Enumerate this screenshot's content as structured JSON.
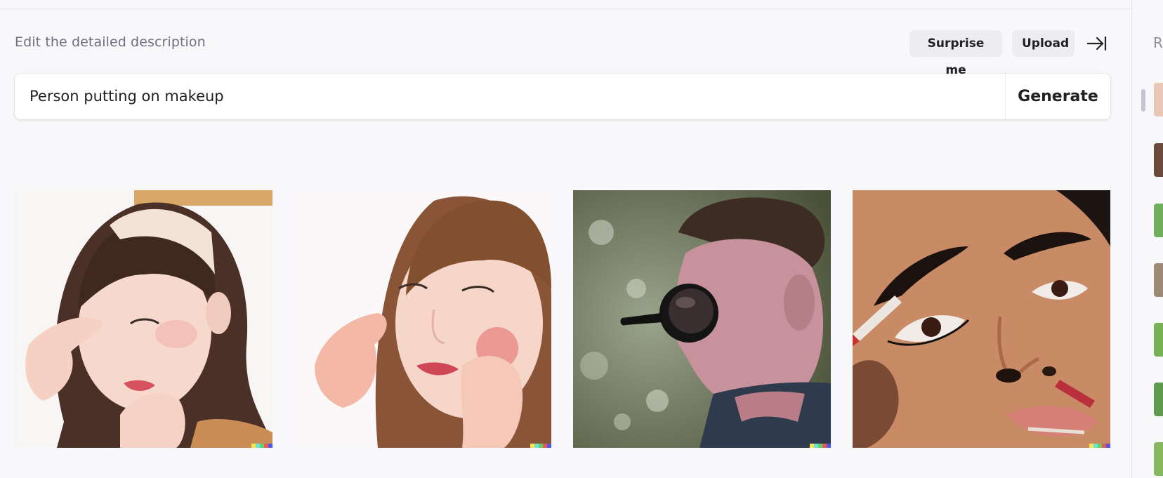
{
  "header": {
    "title": "Edit the detailed description",
    "surprise_label": "Surprise me",
    "upload_label": "Upload"
  },
  "prompt": {
    "value": "Person putting on makeup",
    "generate_label": "Generate"
  },
  "results": [
    {
      "alt": "Woman with headband touching eye"
    },
    {
      "alt": "Woman applying blush to cheek"
    },
    {
      "alt": "Man with dark round glass on nose"
    },
    {
      "alt": "Woman applying eyeliner close-up"
    }
  ],
  "sidebar": {
    "header_letter": "R"
  },
  "colors": {
    "background": "#f8f8fa",
    "button_bg": "#ececf1",
    "text": "#202123",
    "muted": "#6e6e80"
  }
}
